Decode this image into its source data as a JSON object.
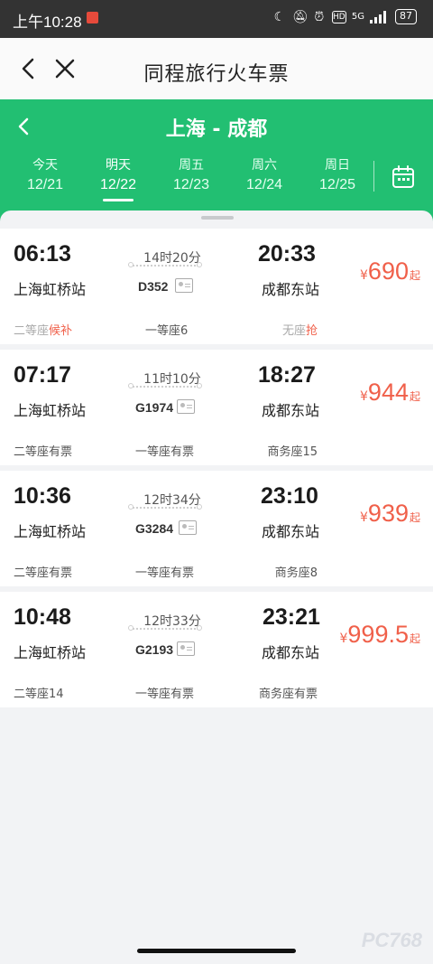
{
  "status_bar": {
    "time": "上午10:28",
    "network": "5G",
    "battery": "87"
  },
  "nav": {
    "title": "同程旅行火车票"
  },
  "route": {
    "title": "上海 - 成都"
  },
  "dates": [
    {
      "weekday": "今天",
      "date": "12/21",
      "active": false
    },
    {
      "weekday": "明天",
      "date": "12/22",
      "active": true
    },
    {
      "weekday": "周五",
      "date": "12/23",
      "active": false
    },
    {
      "weekday": "周六",
      "date": "12/24",
      "active": false
    },
    {
      "weekday": "周日",
      "date": "12/25",
      "active": false
    }
  ],
  "trains": [
    {
      "dep_time": "06:13",
      "dep_station": "上海虹桥站",
      "arr_time": "20:33",
      "arr_station": "成都东站",
      "duration": "14时20分",
      "number": "D352",
      "price_symbol": "¥",
      "price": "690",
      "price_suffix": "起",
      "seat1_name": "二等座",
      "seat1_status": "候补",
      "seat2_name": "一等座",
      "seat2_status": "6",
      "seat3_name": "无座",
      "seat3_status": "抢"
    },
    {
      "dep_time": "07:17",
      "dep_station": "上海虹桥站",
      "arr_time": "18:27",
      "arr_station": "成都东站",
      "duration": "11时10分",
      "number": "G1974",
      "price_symbol": "¥",
      "price": "944",
      "price_suffix": "起",
      "seat1_name": "二等座",
      "seat1_status": "有票",
      "seat2_name": "一等座",
      "seat2_status": "有票",
      "seat3_name": "商务座",
      "seat3_status": "15"
    },
    {
      "dep_time": "10:36",
      "dep_station": "上海虹桥站",
      "arr_time": "23:10",
      "arr_station": "成都东站",
      "duration": "12时34分",
      "number": "G3284",
      "price_symbol": "¥",
      "price": "939",
      "price_suffix": "起",
      "seat1_name": "二等座",
      "seat1_status": "有票",
      "seat2_name": "一等座",
      "seat2_status": "有票",
      "seat3_name": "商务座",
      "seat3_status": "8"
    },
    {
      "dep_time": "10:48",
      "dep_station": "上海虹桥站",
      "arr_time": "23:21",
      "arr_station": "成都东站",
      "duration": "12时33分",
      "number": "G2193",
      "price_symbol": "¥",
      "price": "999.5",
      "price_suffix": "起",
      "seat1_name": "二等座",
      "seat1_status": "14",
      "seat2_name": "一等座",
      "seat2_status": "有票",
      "seat3_name": "商务座",
      "seat3_status": "有票"
    }
  ],
  "watermark": "PC768",
  "colors": {
    "brand_green": "#22bf72",
    "price_red": "#f0604a",
    "status_bar": "#333333"
  }
}
